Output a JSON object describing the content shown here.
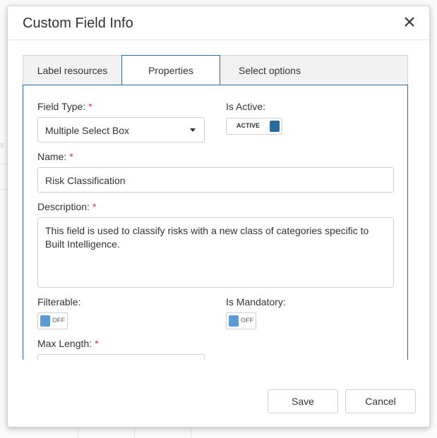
{
  "background": {
    "fragment_text": "s"
  },
  "modal": {
    "title": "Custom Field Info",
    "close_glyph": "close-icon"
  },
  "tabs": [
    {
      "label": "Label resources",
      "active": false
    },
    {
      "label": "Properties",
      "active": true
    },
    {
      "label": "Select options",
      "active": false
    }
  ],
  "form": {
    "field_type": {
      "label": "Field Type:",
      "required_mark": "*",
      "value": "Multiple Select Box"
    },
    "is_active": {
      "label": "Is Active:",
      "toggle_text": "ACTIVE",
      "state": true
    },
    "name": {
      "label": "Name:",
      "required_mark": "*",
      "value": "Risk Classification"
    },
    "description": {
      "label": "Description:",
      "required_mark": "*",
      "value": "This field is used to classify risks with a new class of categories specific to Built Intelligence."
    },
    "filterable": {
      "label": "Filterable:",
      "toggle_text": "OFF",
      "state": false
    },
    "is_mandatory": {
      "label": "Is Mandatory:",
      "toggle_text": "OFF",
      "state": false
    },
    "max_length": {
      "label": "Max Length:",
      "required_mark": "*",
      "value": ""
    }
  },
  "footer": {
    "save_label": "Save",
    "cancel_label": "Cancel"
  },
  "colors": {
    "accent": "#2a6d9c",
    "required": "#d9363e",
    "toggle_off_knob": "#5b9bd5"
  }
}
